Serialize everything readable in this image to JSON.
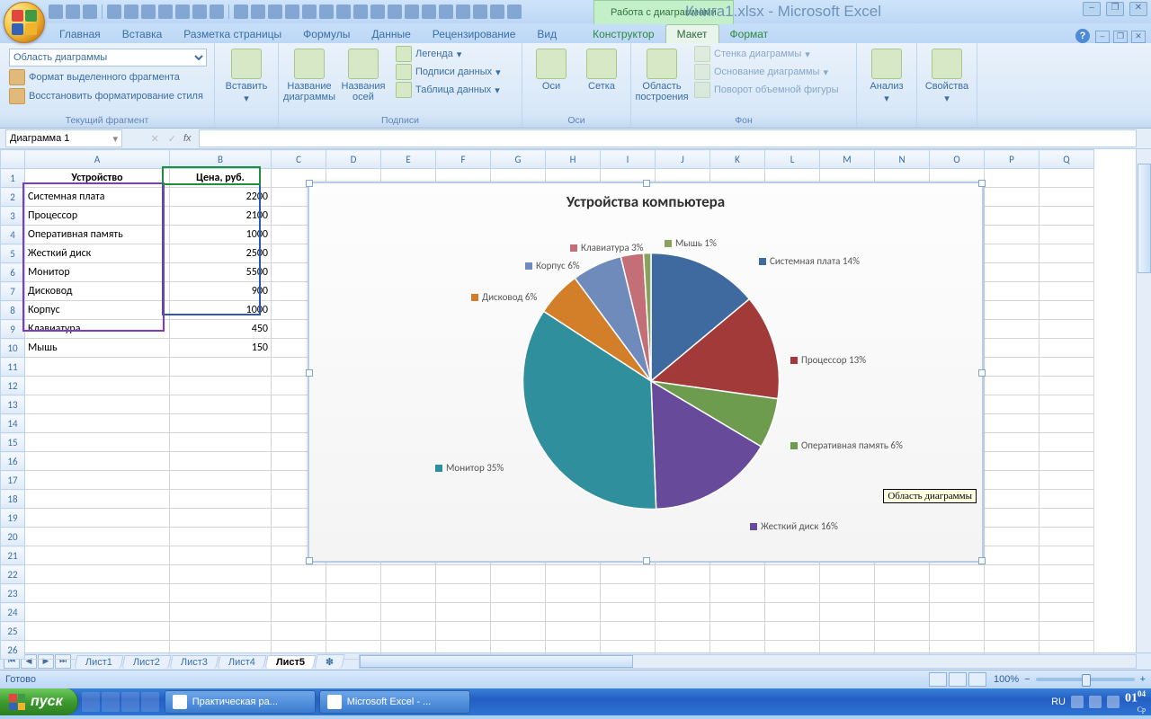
{
  "title": {
    "context_tab": "Работа с диаграммами",
    "doc": "Книга1.xlsx - Microsoft Excel"
  },
  "ribbon_tabs": [
    "Главная",
    "Вставка",
    "Разметка страницы",
    "Формулы",
    "Данные",
    "Рецензирование",
    "Вид"
  ],
  "ribbon_context_tabs": [
    "Конструктор",
    "Макет",
    "Формат"
  ],
  "ribbon_context_active": "Макет",
  "ribbon": {
    "group_current": {
      "label": "Текущий фрагмент",
      "dropdown": "Область диаграммы",
      "btn1": "Формат выделенного фрагмента",
      "btn2": "Восстановить форматирование стиля"
    },
    "group_insert": {
      "label": "",
      "btn": "Вставить"
    },
    "group_labels": {
      "label": "Подписи",
      "btn1": "Название диаграммы",
      "btn2": "Названия осей",
      "s1": "Легенда",
      "s2": "Подписи данных",
      "s3": "Таблица данных"
    },
    "group_axes": {
      "label": "Оси",
      "btn1": "Оси",
      "btn2": "Сетка"
    },
    "group_bg": {
      "label": "Фон",
      "btn1": "Область построения",
      "s1": "Стенка диаграммы",
      "s2": "Основание диаграммы",
      "s3": "Поворот объемной фигуры"
    },
    "group_analysis": {
      "label": "",
      "btn": "Анализ"
    },
    "group_props": {
      "label": "",
      "btn": "Свойства"
    }
  },
  "namebox": "Диаграмма 1",
  "fx_label": "fx",
  "columns": [
    "A",
    "B",
    "C",
    "D",
    "E",
    "F",
    "G",
    "H",
    "I",
    "J",
    "K",
    "L",
    "M",
    "N",
    "O",
    "P",
    "Q"
  ],
  "table": {
    "headers": [
      "Устройство",
      "Цена, руб."
    ],
    "rows": [
      [
        "Системная плата",
        2200
      ],
      [
        "Процессор",
        2100
      ],
      [
        "Оперативная память",
        1000
      ],
      [
        "Жесткий диск",
        2500
      ],
      [
        "Монитор",
        5500
      ],
      [
        "Дисковод",
        900
      ],
      [
        "Корпус",
        1000
      ],
      [
        "Клавиатура",
        450
      ],
      [
        "Мышь",
        150
      ]
    ]
  },
  "chart_data": {
    "type": "pie",
    "title": "Устройства компьютера",
    "categories": [
      "Системная плата",
      "Процессор",
      "Оперативная память",
      "Жесткий диск",
      "Монитор",
      "Дисковод",
      "Корпус",
      "Клавиатура",
      "Мышь"
    ],
    "values": [
      2200,
      2100,
      1000,
      2500,
      5500,
      900,
      1000,
      450,
      150
    ],
    "percent_labels": [
      "Системная плата 14%",
      "Процессор 13%",
      "Оперативная память 6%",
      "Жесткий диск 16%",
      "Монитор 35%",
      "Дисковод 6%",
      "Корпус 6%",
      "Клавиатура 3%",
      "Мышь 1%"
    ],
    "colors": [
      "#3e6aa0",
      "#a33a3a",
      "#6e9c4e",
      "#674a9a",
      "#2f8f9c",
      "#d37f2a",
      "#6f8bbb",
      "#c46f77",
      "#89a25c"
    ]
  },
  "chart_tooltip": "Область диаграммы",
  "sheet_tabs": [
    "Лист1",
    "Лист2",
    "Лист3",
    "Лист4",
    "Лист5"
  ],
  "sheet_active": "Лист5",
  "status": {
    "ready": "Готово",
    "zoom": "100%"
  },
  "taskbar": {
    "start": "пуск",
    "task1": "Практическая ра...",
    "task2": "Microsoft Excel - ...",
    "lang": "RU",
    "time": "01",
    "time_suffix": "04",
    "day": "Ср"
  }
}
